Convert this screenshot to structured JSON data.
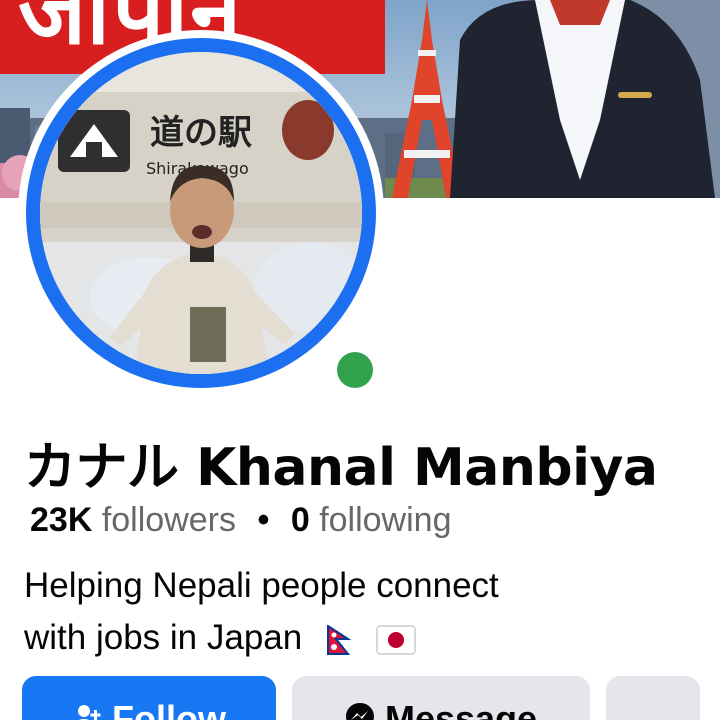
{
  "cover": {
    "banner_text": "जापान"
  },
  "avatar": {
    "sign_text": "道の駅",
    "sign_sub": "Shirakawago",
    "online": true
  },
  "profile": {
    "name": "カナル Khanal Manbiya",
    "followers_count": "23K",
    "followers_label": "followers",
    "separator": "•",
    "following_count": "0",
    "following_label": "following",
    "bio_line1": "Helping Nepali people connect",
    "bio_line2": "with jobs in Japan"
  },
  "actions": {
    "follow_label": "Follow",
    "message_label": "Message",
    "more_label": "…"
  },
  "colors": {
    "primary": "#1877f2",
    "online": "#31a24c",
    "secondary_button": "#e4e6eb",
    "muted_text": "#65676b"
  }
}
